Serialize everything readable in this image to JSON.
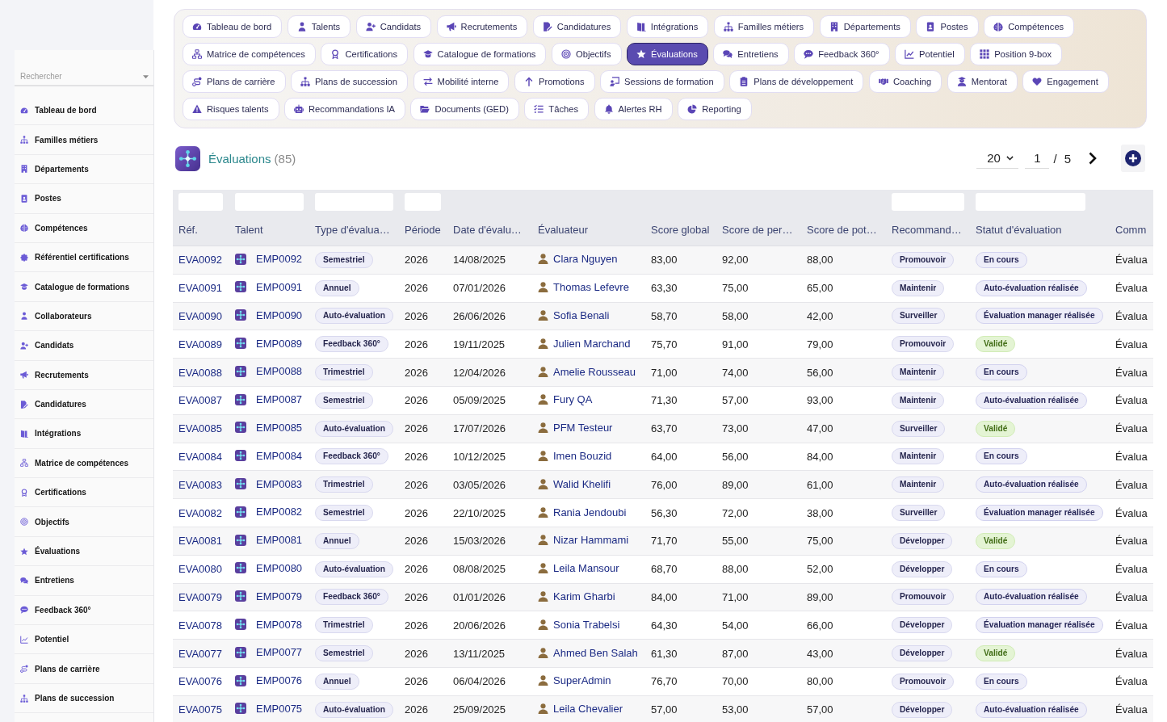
{
  "sidebar": {
    "search": {
      "placeholder": "Rechercher"
    },
    "items": [
      {
        "label": "Tableau de bord"
      },
      {
        "label": "Familles métiers"
      },
      {
        "label": "Départements"
      },
      {
        "label": "Postes"
      },
      {
        "label": "Compétences"
      },
      {
        "label": "Référentiel certifications"
      },
      {
        "label": "Catalogue de formations"
      },
      {
        "label": "Collaborateurs"
      },
      {
        "label": "Candidats"
      },
      {
        "label": "Recrutements"
      },
      {
        "label": "Candidatures"
      },
      {
        "label": "Intégrations"
      },
      {
        "label": "Matrice de compétences"
      },
      {
        "label": "Certifications"
      },
      {
        "label": "Objectifs"
      },
      {
        "label": "Évaluations"
      },
      {
        "label": "Entretiens"
      },
      {
        "label": "Feedback 360°"
      },
      {
        "label": "Potentiel"
      },
      {
        "label": "Plans de carrière"
      },
      {
        "label": "Plans de succession"
      }
    ]
  },
  "nav": {
    "tabs": [
      {
        "label": "Tableau de bord",
        "selected": false
      },
      {
        "label": "Talents",
        "selected": false
      },
      {
        "label": "Candidats",
        "selected": false
      },
      {
        "label": "Recrutements",
        "selected": false
      },
      {
        "label": "Candidatures",
        "selected": false
      },
      {
        "label": "Intégrations",
        "selected": false
      },
      {
        "label": "Familles métiers",
        "selected": false
      },
      {
        "label": "Départements",
        "selected": false
      },
      {
        "label": "Postes",
        "selected": false
      },
      {
        "label": "Compétences",
        "selected": false
      },
      {
        "label": "Matrice de compétences",
        "selected": false
      },
      {
        "label": "Certifications",
        "selected": false
      },
      {
        "label": "Catalogue de formations",
        "selected": false
      },
      {
        "label": "Objectifs",
        "selected": false
      },
      {
        "label": "Évaluations",
        "selected": true
      },
      {
        "label": "Entretiens",
        "selected": false
      },
      {
        "label": "Feedback 360°",
        "selected": false
      },
      {
        "label": "Potentiel",
        "selected": false
      },
      {
        "label": "Position 9-box",
        "selected": false
      },
      {
        "label": "Plans de carrière",
        "selected": false
      },
      {
        "label": "Plans de succession",
        "selected": false
      },
      {
        "label": "Mobilité interne",
        "selected": false
      },
      {
        "label": "Promotions",
        "selected": false
      },
      {
        "label": "Sessions de formation",
        "selected": false
      },
      {
        "label": "Plans de développement",
        "selected": false
      },
      {
        "label": "Coaching",
        "selected": false
      },
      {
        "label": "Mentorat",
        "selected": false
      },
      {
        "label": "Engagement",
        "selected": false
      },
      {
        "label": "Risques talents",
        "selected": false
      },
      {
        "label": "Recommandations IA",
        "selected": false
      },
      {
        "label": "Documents (GED)",
        "selected": false
      },
      {
        "label": "Tâches",
        "selected": false
      },
      {
        "label": "Alertes RH",
        "selected": false
      },
      {
        "label": "Reporting",
        "selected": false
      }
    ]
  },
  "header": {
    "title": "Évaluations",
    "count": "(85)",
    "page_size": "20",
    "page": "1",
    "page_separator": "/",
    "page_total": "5"
  },
  "table": {
    "columns": [
      {
        "label": "Réf.",
        "filter": true
      },
      {
        "label": "Talent",
        "filter": true
      },
      {
        "label": "Type d'évalua…",
        "filter": true
      },
      {
        "label": "Période",
        "filter": true
      },
      {
        "label": "Date d'évalu…",
        "filter": false
      },
      {
        "label": "Évaluateur",
        "filter": false
      },
      {
        "label": "Score global",
        "filter": false
      },
      {
        "label": "Score de per…",
        "filter": false
      },
      {
        "label": "Score de pot…",
        "filter": false
      },
      {
        "label": "Recommand…",
        "filter": true
      },
      {
        "label": "Statut d'évaluation",
        "filter": true
      },
      {
        "label": "Comm",
        "filter": false
      }
    ],
    "rows": [
      {
        "ref": "EVA0092",
        "talent": "EMP0092",
        "type_d_evalua": "Semestriel",
        "periode": "2026",
        "date_d_evalu": "14/08/2025",
        "evaluateur": "Clara Nguyen",
        "score_global": "83,00",
        "score_de_per": "92,00",
        "score_de_pot": "88,00",
        "recommand": "Promouvoir",
        "statut": {
          "label": "En cours",
          "color": "#eeeef9"
        },
        "comm": "Évalua"
      },
      {
        "ref": "EVA0091",
        "talent": "EMP0091",
        "type_d_evalua": "Annuel",
        "periode": "2026",
        "date_d_evalu": "07/01/2026",
        "evaluateur": "Thomas Lefevre",
        "score_global": "63,30",
        "score_de_per": "75,00",
        "score_de_pot": "65,00",
        "recommand": "Maintenir",
        "statut": {
          "label": "Auto-évaluation réalisée",
          "color": "#eeeef9"
        },
        "comm": "Évalua"
      },
      {
        "ref": "EVA0090",
        "talent": "EMP0090",
        "type_d_evalua": "Auto-évaluation",
        "periode": "2026",
        "date_d_evalu": "26/06/2026",
        "evaluateur": "Sofia Benali",
        "score_global": "58,70",
        "score_de_per": "58,00",
        "score_de_pot": "42,00",
        "recommand": "Surveiller",
        "statut": {
          "label": "Évaluation manager réalisée",
          "color": "#eeeef9"
        },
        "comm": "Évalua"
      },
      {
        "ref": "EVA0089",
        "talent": "EMP0089",
        "type_d_evalua": "Feedback 360°",
        "periode": "2026",
        "date_d_evalu": "19/11/2025",
        "evaluateur": "Julien Marchand",
        "score_global": "75,70",
        "score_de_per": "91,00",
        "score_de_pot": "79,00",
        "recommand": "Promouvoir",
        "statut": {
          "label": "Validé",
          "color": "#e4f4d4"
        },
        "comm": "Évalua"
      },
      {
        "ref": "EVA0088",
        "talent": "EMP0088",
        "type_d_evalua": "Trimestriel",
        "periode": "2026",
        "date_d_evalu": "12/04/2026",
        "evaluateur": "Amelie Rousseau",
        "score_global": "71,00",
        "score_de_per": "74,00",
        "score_de_pot": "56,00",
        "recommand": "Maintenir",
        "statut": {
          "label": "En cours",
          "color": "#eeeef9"
        },
        "comm": "Évalua"
      },
      {
        "ref": "EVA0087",
        "talent": "EMP0087",
        "type_d_evalua": "Semestriel",
        "periode": "2026",
        "date_d_evalu": "05/09/2025",
        "evaluateur": "Fury QA",
        "score_global": "71,30",
        "score_de_per": "57,00",
        "score_de_pot": "93,00",
        "recommand": "Maintenir",
        "statut": {
          "label": "Auto-évaluation réalisée",
          "color": "#eeeef9"
        },
        "comm": "Évalua"
      },
      {
        "ref": "EVA0085",
        "talent": "EMP0085",
        "type_d_evalua": "Auto-évaluation",
        "periode": "2026",
        "date_d_evalu": "17/07/2026",
        "evaluateur": "PFM Testeur",
        "score_global": "63,70",
        "score_de_per": "73,00",
        "score_de_pot": "47,00",
        "recommand": "Surveiller",
        "statut": {
          "label": "Validé",
          "color": "#e4f4d4"
        },
        "comm": "Évalua"
      },
      {
        "ref": "EVA0084",
        "talent": "EMP0084",
        "type_d_evalua": "Feedback 360°",
        "periode": "2026",
        "date_d_evalu": "10/12/2025",
        "evaluateur": "Imen Bouzid",
        "score_global": "64,00",
        "score_de_per": "56,00",
        "score_de_pot": "84,00",
        "recommand": "Maintenir",
        "statut": {
          "label": "En cours",
          "color": "#eeeef9"
        },
        "comm": "Évalua"
      },
      {
        "ref": "EVA0083",
        "talent": "EMP0083",
        "type_d_evalua": "Trimestriel",
        "periode": "2026",
        "date_d_evalu": "03/05/2026",
        "evaluateur": "Walid Khelifi",
        "score_global": "76,00",
        "score_de_per": "89,00",
        "score_de_pot": "61,00",
        "recommand": "Maintenir",
        "statut": {
          "label": "Auto-évaluation réalisée",
          "color": "#eeeef9"
        },
        "comm": "Évalua"
      },
      {
        "ref": "EVA0082",
        "talent": "EMP0082",
        "type_d_evalua": "Semestriel",
        "periode": "2026",
        "date_d_evalu": "22/10/2025",
        "evaluateur": "Rania Jendoubi",
        "score_global": "56,30",
        "score_de_per": "72,00",
        "score_de_pot": "38,00",
        "recommand": "Surveiller",
        "statut": {
          "label": "Évaluation manager réalisée",
          "color": "#eeeef9"
        },
        "comm": "Évalua"
      },
      {
        "ref": "EVA0081",
        "talent": "EMP0081",
        "type_d_evalua": "Annuel",
        "periode": "2026",
        "date_d_evalu": "15/03/2026",
        "evaluateur": "Nizar Hammami",
        "score_global": "71,70",
        "score_de_per": "55,00",
        "score_de_pot": "75,00",
        "recommand": "Développer",
        "statut": {
          "label": "Validé",
          "color": "#e4f4d4"
        },
        "comm": "Évalua"
      },
      {
        "ref": "EVA0080",
        "talent": "EMP0080",
        "type_d_evalua": "Auto-évaluation",
        "periode": "2026",
        "date_d_evalu": "08/08/2025",
        "evaluateur": "Leila Mansour",
        "score_global": "68,70",
        "score_de_per": "88,00",
        "score_de_pot": "52,00",
        "recommand": "Développer",
        "statut": {
          "label": "En cours",
          "color": "#eeeef9"
        },
        "comm": "Évalua"
      },
      {
        "ref": "EVA0079",
        "talent": "EMP0079",
        "type_d_evalua": "Feedback 360°",
        "periode": "2026",
        "date_d_evalu": "01/01/2026",
        "evaluateur": "Karim Gharbi",
        "score_global": "84,00",
        "score_de_per": "71,00",
        "score_de_pot": "89,00",
        "recommand": "Promouvoir",
        "statut": {
          "label": "Auto-évaluation réalisée",
          "color": "#eeeef9"
        },
        "comm": "Évalua"
      },
      {
        "ref": "EVA0078",
        "talent": "EMP0078",
        "type_d_evalua": "Trimestriel",
        "periode": "2026",
        "date_d_evalu": "20/06/2026",
        "evaluateur": "Sonia Trabelsi",
        "score_global": "64,30",
        "score_de_per": "54,00",
        "score_de_pot": "66,00",
        "recommand": "Développer",
        "statut": {
          "label": "Évaluation manager réalisée",
          "color": "#eeeef9"
        },
        "comm": "Évalua"
      },
      {
        "ref": "EVA0077",
        "talent": "EMP0077",
        "type_d_evalua": "Semestriel",
        "periode": "2026",
        "date_d_evalu": "13/11/2025",
        "evaluateur": "Ahmed Ben Salah",
        "score_global": "61,30",
        "score_de_per": "87,00",
        "score_de_pot": "43,00",
        "recommand": "Développer",
        "statut": {
          "label": "Validé",
          "color": "#e4f4d4"
        },
        "comm": "Évalua"
      },
      {
        "ref": "EVA0076",
        "talent": "EMP0076",
        "type_d_evalua": "Annuel",
        "periode": "2026",
        "date_d_evalu": "06/04/2026",
        "evaluateur": "SuperAdmin",
        "score_global": "76,70",
        "score_de_per": "70,00",
        "score_de_pot": "80,00",
        "recommand": "Promouvoir",
        "statut": {
          "label": "En cours",
          "color": "#eeeef9"
        },
        "comm": "Évalua"
      },
      {
        "ref": "EVA0075",
        "talent": "EMP0075",
        "type_d_evalua": "Auto-évaluation",
        "periode": "2026",
        "date_d_evalu": "25/09/2025",
        "evaluateur": "Leila Chevalier",
        "score_global": "57,00",
        "score_de_per": "53,00",
        "score_de_pot": "57,00",
        "recommand": "Développer",
        "statut": {
          "label": "Auto-évaluation réalisée",
          "color": "#eeeef9"
        },
        "comm": "Évalua"
      }
    ]
  }
}
